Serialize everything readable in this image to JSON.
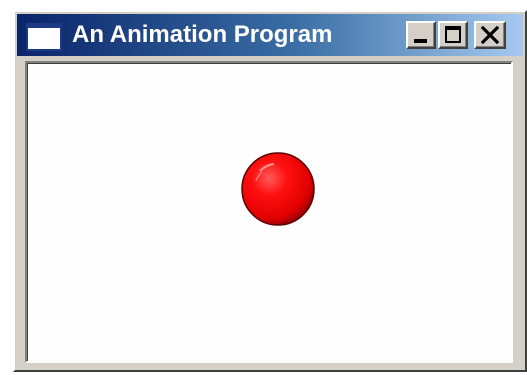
{
  "window": {
    "title": "An Animation Program",
    "controls": {
      "minimize": "minimize-icon",
      "maximize": "maximize-icon",
      "close": "close-icon"
    },
    "colors": {
      "titlebar_start": "#0a246a",
      "titlebar_end": "#a6caf0",
      "frame": "#d4d0c8",
      "client": "#fefefe"
    }
  },
  "canvas": {
    "object": "ball",
    "color": "#ff0000"
  }
}
